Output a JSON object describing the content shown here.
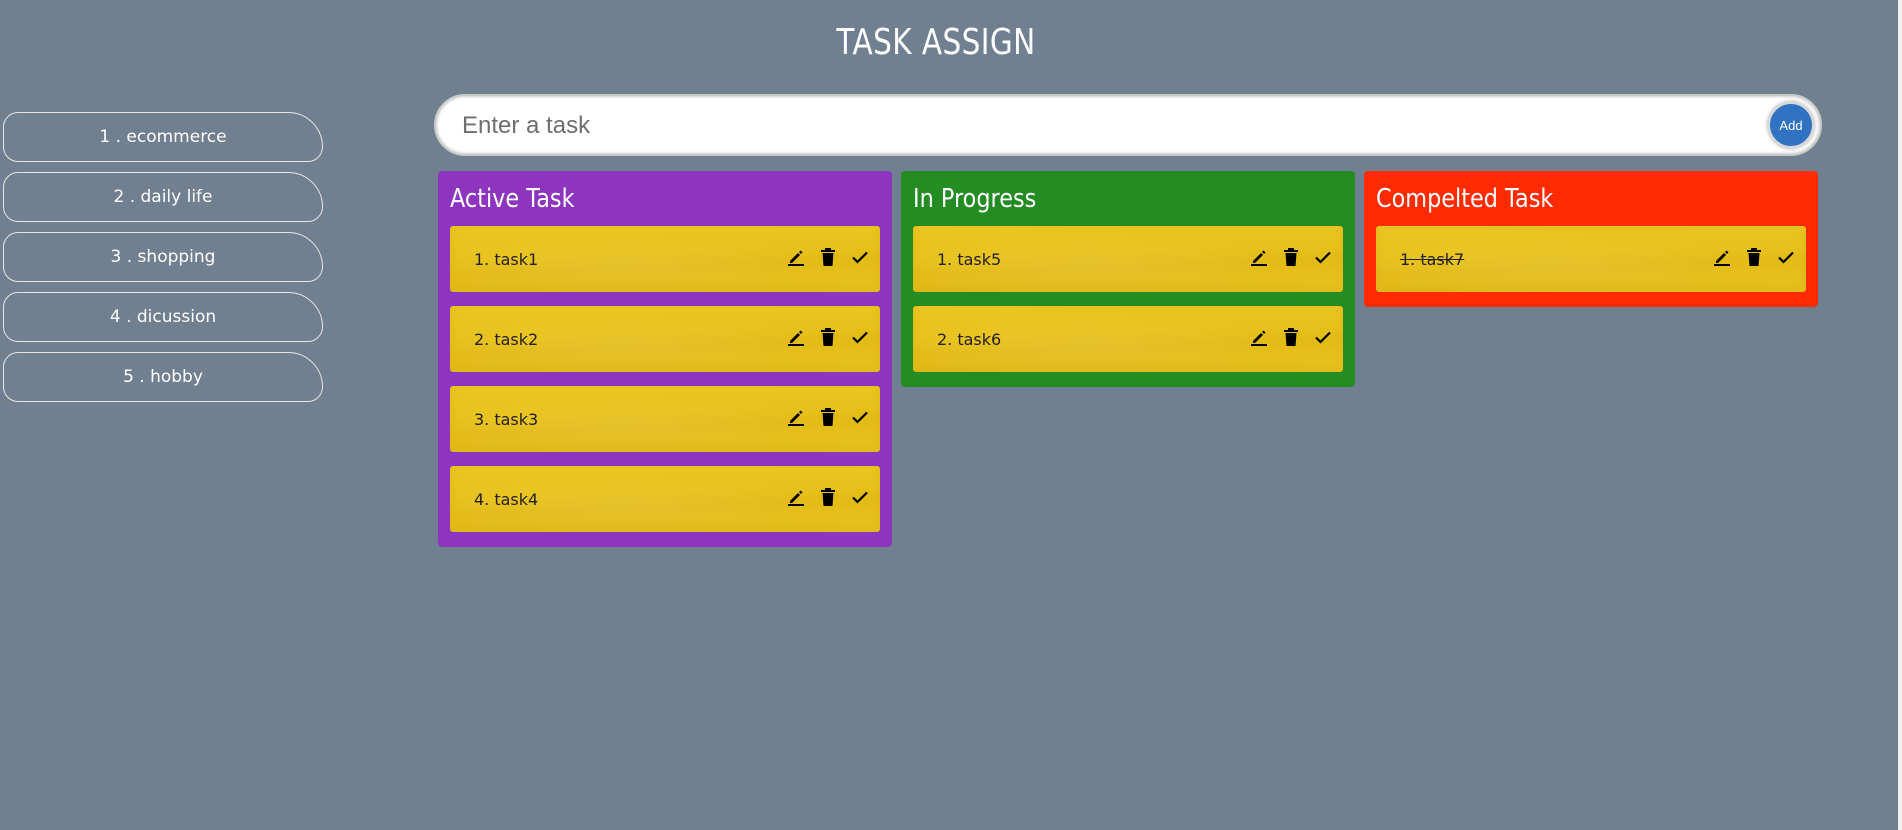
{
  "header": {
    "title": "TASK ASSIGN"
  },
  "sidebar": {
    "items": [
      {
        "label": "1 . ecommerce"
      },
      {
        "label": "2 . daily life"
      },
      {
        "label": "3 . shopping"
      },
      {
        "label": "4 . dicussion"
      },
      {
        "label": "5 . hobby"
      }
    ]
  },
  "task_input": {
    "placeholder": "Enter a task",
    "value": "",
    "add_label": "Add",
    "add_color": "#2f73c2"
  },
  "columns": [
    {
      "title": "Active Task",
      "color": "#8e35c0",
      "tasks": [
        {
          "label": "1. task1"
        },
        {
          "label": "2. task2"
        },
        {
          "label": "3. task3"
        },
        {
          "label": "4. task4"
        }
      ]
    },
    {
      "title": "In Progress",
      "color": "#238c23",
      "tasks": [
        {
          "label": "1. task5"
        },
        {
          "label": "2. task6"
        }
      ]
    },
    {
      "title": "Compelted Task",
      "color": "#ff2b00",
      "tasks": [
        {
          "label": "1. task7",
          "completed": true
        }
      ]
    }
  ],
  "task_icons": [
    "edit-icon",
    "trash-icon",
    "check-icon"
  ],
  "colors": {
    "background": "#708090",
    "task_card": "#ecc620"
  }
}
